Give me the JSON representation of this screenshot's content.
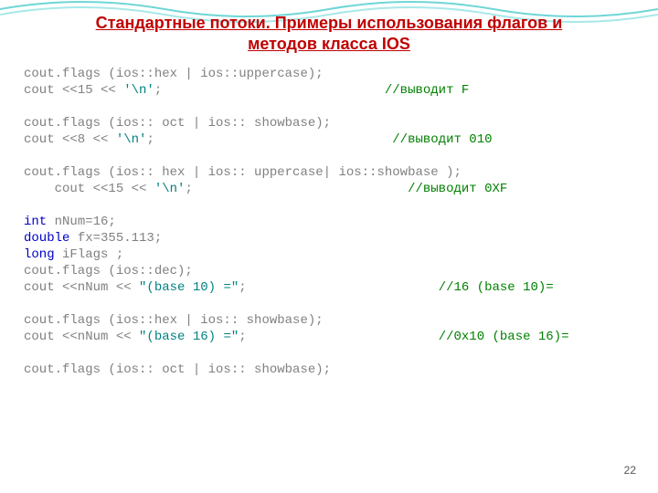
{
  "title_line1": "Стандартные потоки. Примеры использования флагов и",
  "title_line2": "методов класса IOS",
  "page_number": "22",
  "code": {
    "l1a": "cout.flags (ios::hex | ios::uppercase);",
    "l2a": "cout <<15 << ",
    "l2s": "'\\n'",
    "l2b": ";                             ",
    "l2c": "//выводит F",
    "l3": "",
    "l4a": "cout.flags (ios:: oct | ios:: showbase);",
    "l5a": "cout <<8 << ",
    "l5s": "'\\n'",
    "l5b": ";                               ",
    "l5c": "//выводит 010",
    "l6": "",
    "l7a": "cout.flags (ios:: hex | ios:: uppercase| ios::showbase );",
    "l8a": "    cout <<15 << ",
    "l8s": "'\\n'",
    "l8b": ";                            ",
    "l8c": "//выводит 0XF",
    "l9": "",
    "l10k": "int",
    "l10b": " nNum=16;",
    "l11k": "double",
    "l11b": " fx=355.113;",
    "l12k": "long",
    "l12b": " iFlags ;",
    "l13a": "cout.flags (ios::dec);",
    "l14a": "cout <<nNum << ",
    "l14s": "\"(base 10) =\"",
    "l14b": ";                         ",
    "l14c": "//16 (base 10)=",
    "l15": "",
    "l16a": "cout.flags (ios::hex | ios:: showbase);",
    "l17a": "cout <<nNum << ",
    "l17s": "\"(base 16) =\"",
    "l17b": ";                         ",
    "l17c": "//0x10 (base 16)=",
    "l18": "",
    "l19a": "cout.flags (ios:: oct | ios:: showbase);"
  }
}
